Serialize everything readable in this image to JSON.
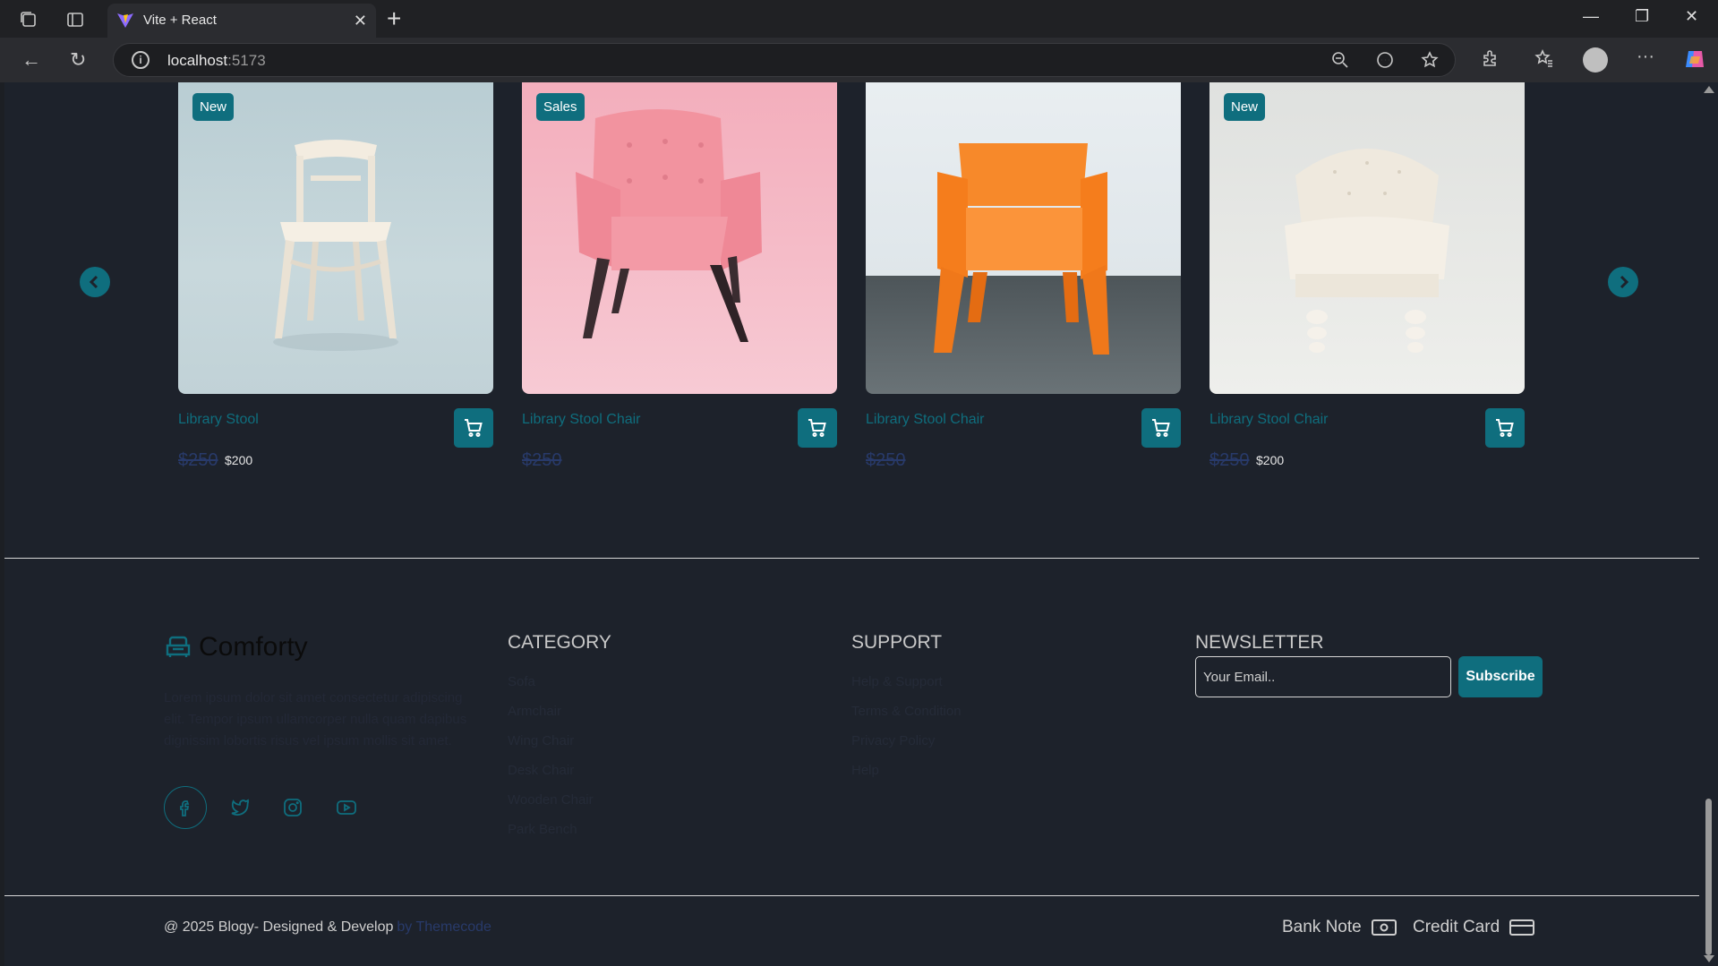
{
  "browser": {
    "tab_title": "Vite + React",
    "url_host": "localhost",
    "url_port": ":5173"
  },
  "products": [
    {
      "badge": "New",
      "name": "Library Stool",
      "old_price": "$250",
      "price": "$200"
    },
    {
      "badge": "Sales",
      "name": "Library Stool Chair",
      "old_price": "$250",
      "price": ""
    },
    {
      "badge": "",
      "name": "Library Stool Chair",
      "old_price": "$250",
      "price": ""
    },
    {
      "badge": "New",
      "name": "Library Stool Chair",
      "old_price": "$250",
      "price": "$200"
    }
  ],
  "footer": {
    "brand": "Comforty",
    "description": "Lorem ipsum dolor sit amet consectetur adipiscing elit. Tempor ipsum ullamcorper nulla quam dapibus dignissim lobortis risus vel ipsum mollis sit amet.",
    "category_title": "CATEGORY",
    "categories": [
      "Sofa",
      "Armchair",
      "Wing Chair",
      "Desk Chair",
      "Wooden Chair",
      "Park Bench"
    ],
    "support_title": "SUPPORT",
    "support": [
      "Help & Support",
      "Terms & Condition",
      "Privacy Policy",
      "Help"
    ],
    "newsletter_title": "NEWSLETTER",
    "email_placeholder": "Your Email..",
    "subscribe_label": "Subscribe",
    "copyright": "@ 2025 Blogy- Designed & Develop",
    "copyright_by": "by Themecode",
    "pay_bank": "Bank Note",
    "pay_card": "Credit Card"
  },
  "colors": {
    "accent": "#0f6e7e",
    "page_bg": "#1d222b"
  }
}
